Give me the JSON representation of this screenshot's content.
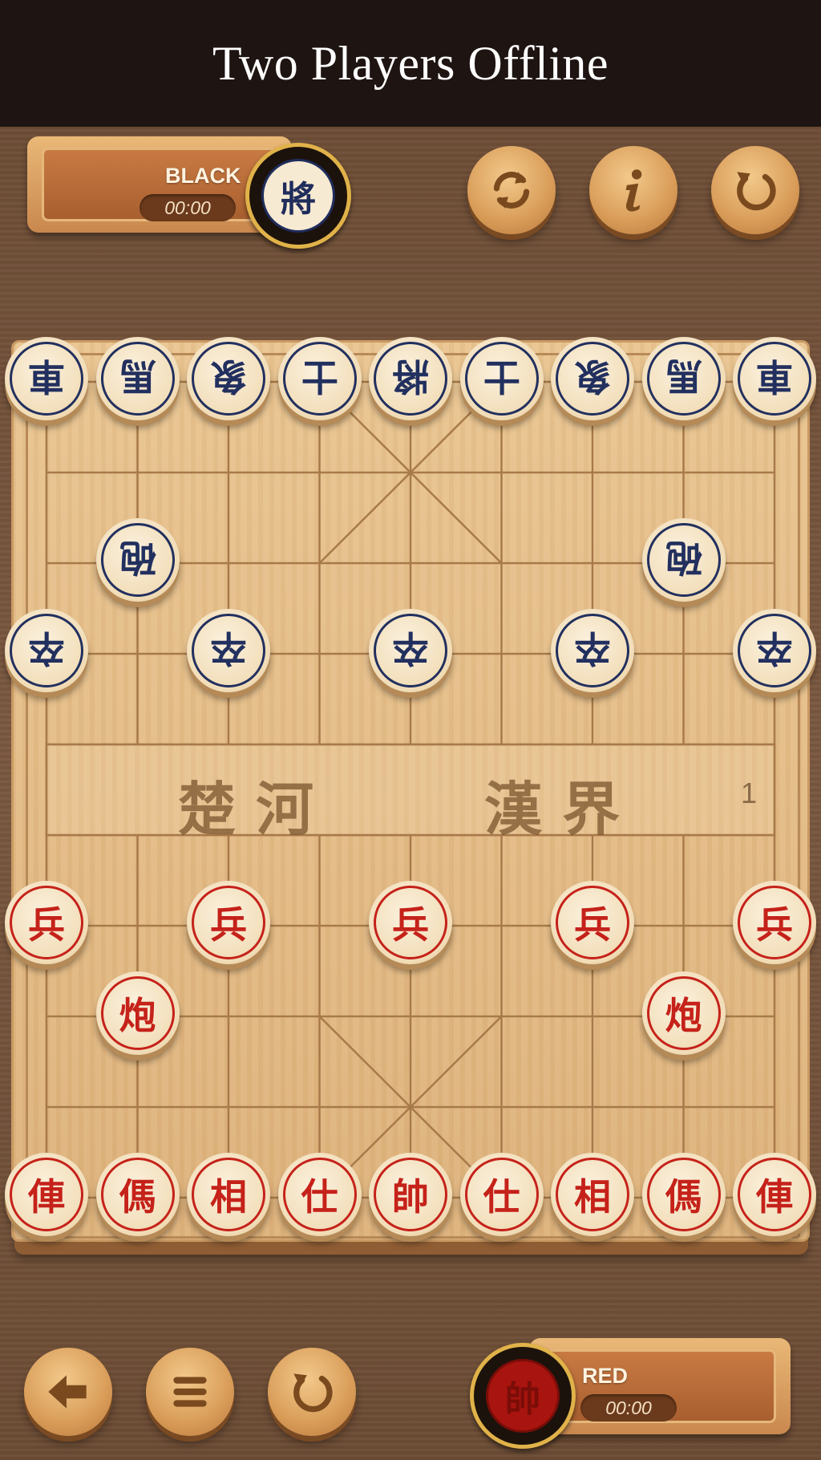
{
  "header": {
    "title": "Two Players Offline"
  },
  "players": {
    "black": {
      "label": "BLACK",
      "timer": "00:00",
      "avatar_glyph": "將"
    },
    "red": {
      "label": "RED",
      "timer": "00:00",
      "avatar_glyph": "帥"
    }
  },
  "top_buttons": [
    {
      "name": "swap-sides-button",
      "icon": "swap-icon"
    },
    {
      "name": "info-button",
      "icon": "info-icon"
    },
    {
      "name": "restart-button",
      "icon": "restart-icon"
    }
  ],
  "bottom_buttons": [
    {
      "name": "back-button",
      "icon": "back-arrow-icon"
    },
    {
      "name": "menu-button",
      "icon": "menu-icon"
    },
    {
      "name": "undo-button",
      "icon": "undo-icon"
    }
  ],
  "river": {
    "left": "楚 河",
    "right": "漢 界"
  },
  "move_count": "1",
  "pieces": {
    "black": [
      {
        "glyph": "車",
        "file": 0,
        "rank": 0
      },
      {
        "glyph": "馬",
        "file": 1,
        "rank": 0
      },
      {
        "glyph": "象",
        "file": 2,
        "rank": 0
      },
      {
        "glyph": "士",
        "file": 3,
        "rank": 0
      },
      {
        "glyph": "將",
        "file": 4,
        "rank": 0
      },
      {
        "glyph": "士",
        "file": 5,
        "rank": 0
      },
      {
        "glyph": "象",
        "file": 6,
        "rank": 0
      },
      {
        "glyph": "馬",
        "file": 7,
        "rank": 0
      },
      {
        "glyph": "車",
        "file": 8,
        "rank": 0
      },
      {
        "glyph": "砲",
        "file": 1,
        "rank": 2
      },
      {
        "glyph": "砲",
        "file": 7,
        "rank": 2
      },
      {
        "glyph": "卒",
        "file": 0,
        "rank": 3
      },
      {
        "glyph": "卒",
        "file": 2,
        "rank": 3
      },
      {
        "glyph": "卒",
        "file": 4,
        "rank": 3
      },
      {
        "glyph": "卒",
        "file": 6,
        "rank": 3
      },
      {
        "glyph": "卒",
        "file": 8,
        "rank": 3
      }
    ],
    "red": [
      {
        "glyph": "兵",
        "file": 0,
        "rank": 6
      },
      {
        "glyph": "兵",
        "file": 2,
        "rank": 6
      },
      {
        "glyph": "兵",
        "file": 4,
        "rank": 6
      },
      {
        "glyph": "兵",
        "file": 6,
        "rank": 6
      },
      {
        "glyph": "兵",
        "file": 8,
        "rank": 6
      },
      {
        "glyph": "炮",
        "file": 1,
        "rank": 7
      },
      {
        "glyph": "炮",
        "file": 7,
        "rank": 7
      },
      {
        "glyph": "俥",
        "file": 0,
        "rank": 9
      },
      {
        "glyph": "傌",
        "file": 1,
        "rank": 9
      },
      {
        "glyph": "相",
        "file": 2,
        "rank": 9
      },
      {
        "glyph": "仕",
        "file": 3,
        "rank": 9
      },
      {
        "glyph": "帥",
        "file": 4,
        "rank": 9
      },
      {
        "glyph": "仕",
        "file": 5,
        "rank": 9
      },
      {
        "glyph": "相",
        "file": 6,
        "rank": 9
      },
      {
        "glyph": "傌",
        "file": 7,
        "rank": 9
      },
      {
        "glyph": "俥",
        "file": 8,
        "rank": 9
      }
    ]
  }
}
